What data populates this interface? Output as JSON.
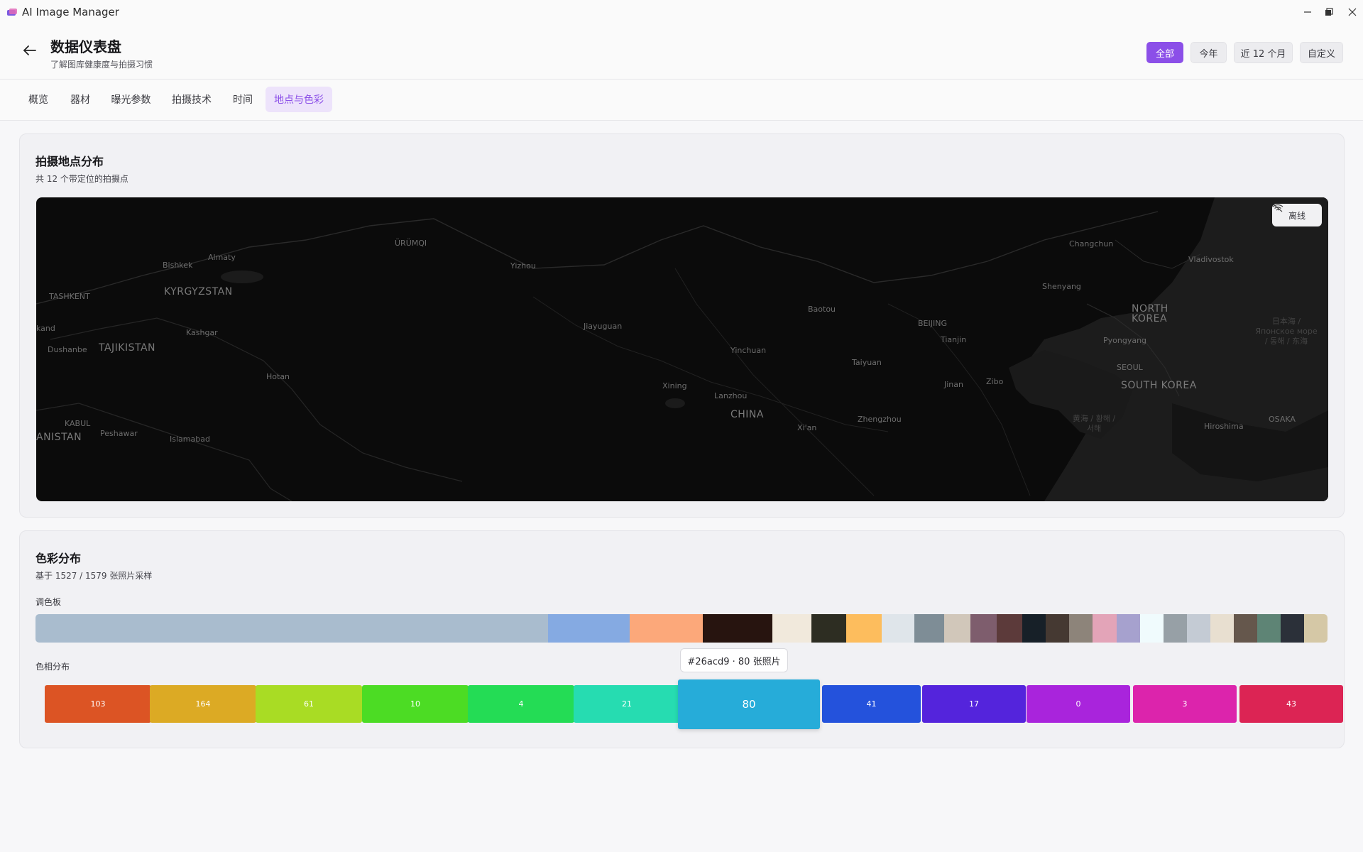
{
  "window": {
    "title": "AI Image Manager",
    "controls": [
      "minimize",
      "maximize",
      "close"
    ]
  },
  "header": {
    "title": "数据仪表盘",
    "subtitle": "了解图库健康度与拍摄习惯",
    "ranges": [
      {
        "label": "全部",
        "active": true
      },
      {
        "label": "今年",
        "active": false
      },
      {
        "label": "近 12 个月",
        "active": false
      },
      {
        "label": "自定义",
        "active": false
      }
    ]
  },
  "tabs": [
    {
      "label": "概览",
      "active": false
    },
    {
      "label": "器材",
      "active": false
    },
    {
      "label": "曝光参数",
      "active": false
    },
    {
      "label": "拍摄技术",
      "active": false
    },
    {
      "label": "时间",
      "active": false
    },
    {
      "label": "地点与色彩",
      "active": true
    }
  ],
  "location_card": {
    "title": "拍摄地点分布",
    "subtitle": "共 12 个带定位的拍摄点",
    "offline_label": "离线",
    "map_labels": {
      "cities": [
        "ÜRÜMQI",
        "Almaty",
        "Bishkek",
        "TASHKENT",
        "Kashgar",
        "Dushanbe",
        "Hotan",
        "KABUL",
        "Peshawar",
        "Islamabad",
        "Yizhou",
        "Jiayuguan",
        "Xining",
        "Lanzhou",
        "Yinchuan",
        "Baotou",
        "BEIJING",
        "Tianjin",
        "Taiyuan",
        "Jinan",
        "Zibo",
        "Zhengzhou",
        "Xi'an",
        "Shenyang",
        "Changchun",
        "Vladivostok",
        "Pyongyang",
        "SEOUL",
        "Hiroshima",
        "OSAKA",
        "kand"
      ],
      "countries": [
        "KYRGYZSTAN",
        "TAJIKISTAN",
        "ANISTAN",
        "CHINA",
        "NORTH KOREA",
        "SOUTH KOREA"
      ],
      "seas": [
        "日本海 / Японское море / 동해 / 东海",
        "黄海 / 황해 / 서해"
      ]
    }
  },
  "color_card": {
    "title": "色彩分布",
    "subtitle": "基于 1527 / 1579 张照片采样",
    "palette_label": "调色板",
    "palette": [
      {
        "color": "#a9bcce",
        "share": 39.3
      },
      {
        "color": "#85aae2",
        "share": 6.3
      },
      {
        "color": "#fca87a",
        "share": 5.6
      },
      {
        "color": "#27140f",
        "share": 5.3
      },
      {
        "color": "#f1e9dc",
        "share": 3.0
      },
      {
        "color": "#2d2d22",
        "share": 2.7
      },
      {
        "color": "#fdbd5d",
        "share": 2.7
      },
      {
        "color": "#dfe5ea",
        "share": 2.5
      },
      {
        "color": "#7e8d96",
        "share": 2.3
      },
      {
        "color": "#d1c7ba",
        "share": 2.0
      },
      {
        "color": "#7e5d6d",
        "share": 2.0
      },
      {
        "color": "#5c3a3a",
        "share": 2.0
      },
      {
        "color": "#172028",
        "share": 1.8
      },
      {
        "color": "#453932",
        "share": 1.8
      },
      {
        "color": "#8d847a",
        "share": 1.8
      },
      {
        "color": "#e3a4b8",
        "share": 1.8
      },
      {
        "color": "#a6a1ce",
        "share": 1.8
      },
      {
        "color": "#f0fbfd",
        "share": 1.8
      },
      {
        "color": "#97a0a6",
        "share": 1.8
      },
      {
        "color": "#c4cbd4",
        "share": 1.8
      },
      {
        "color": "#e8dfd0",
        "share": 1.8
      },
      {
        "color": "#65574c",
        "share": 1.8
      },
      {
        "color": "#5e8475",
        "share": 1.8
      },
      {
        "color": "#2b3039",
        "share": 1.8
      },
      {
        "color": "#d5c8a6",
        "share": 1.8
      }
    ],
    "hue_label": "色相分布",
    "tooltip": "#26acd9 · 80 张照片",
    "hues": [
      {
        "count": "103",
        "color": "#dc5424"
      },
      {
        "count": "164",
        "color": "#dcaa24"
      },
      {
        "count": "61",
        "color": "#a9dc24"
      },
      {
        "count": "10",
        "color": "#4cdc24"
      },
      {
        "count": "4",
        "color": "#24dc55"
      },
      {
        "count": "21",
        "color": "#26dcb1"
      },
      {
        "count": "80",
        "color": "#26acd9",
        "highlight": true
      },
      {
        "count": "41",
        "color": "#2452dc"
      },
      {
        "count": "17",
        "color": "#5424dc"
      },
      {
        "count": "0",
        "color": "#a924dc"
      },
      {
        "count": "3",
        "color": "#dc24ac"
      },
      {
        "count": "43",
        "color": "#dc2454"
      }
    ]
  }
}
